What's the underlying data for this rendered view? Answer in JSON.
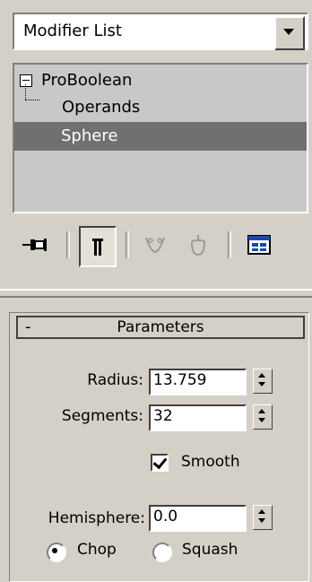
{
  "modifier_list": {
    "label": "Modifier List"
  },
  "stack": {
    "items": [
      {
        "label": "ProBoolean"
      },
      {
        "label": "Operands"
      },
      {
        "label": "Sphere"
      }
    ]
  },
  "toolbar": {
    "icons": [
      "pin-stack-icon",
      "show-end-result-icon",
      "make-unique-icon",
      "remove-modifier-icon",
      "configure-modifier-sets-icon"
    ]
  },
  "parameters": {
    "title": "Parameters",
    "collapse_symbol": "-",
    "radius": {
      "label": "Radius:",
      "value": "13.759"
    },
    "segments": {
      "label": "Segments:",
      "value": "32"
    },
    "smooth": {
      "label": "Smooth",
      "checked": true
    },
    "hemisphere": {
      "label": "Hemisphere:",
      "value": "0.0"
    },
    "chop": {
      "label": "Chop",
      "selected": true
    },
    "squash": {
      "label": "Squash",
      "selected": false
    }
  },
  "colors": {
    "panel": "#d4d0c8",
    "selection": "#707070",
    "list_bg": "#c8c8c8"
  }
}
